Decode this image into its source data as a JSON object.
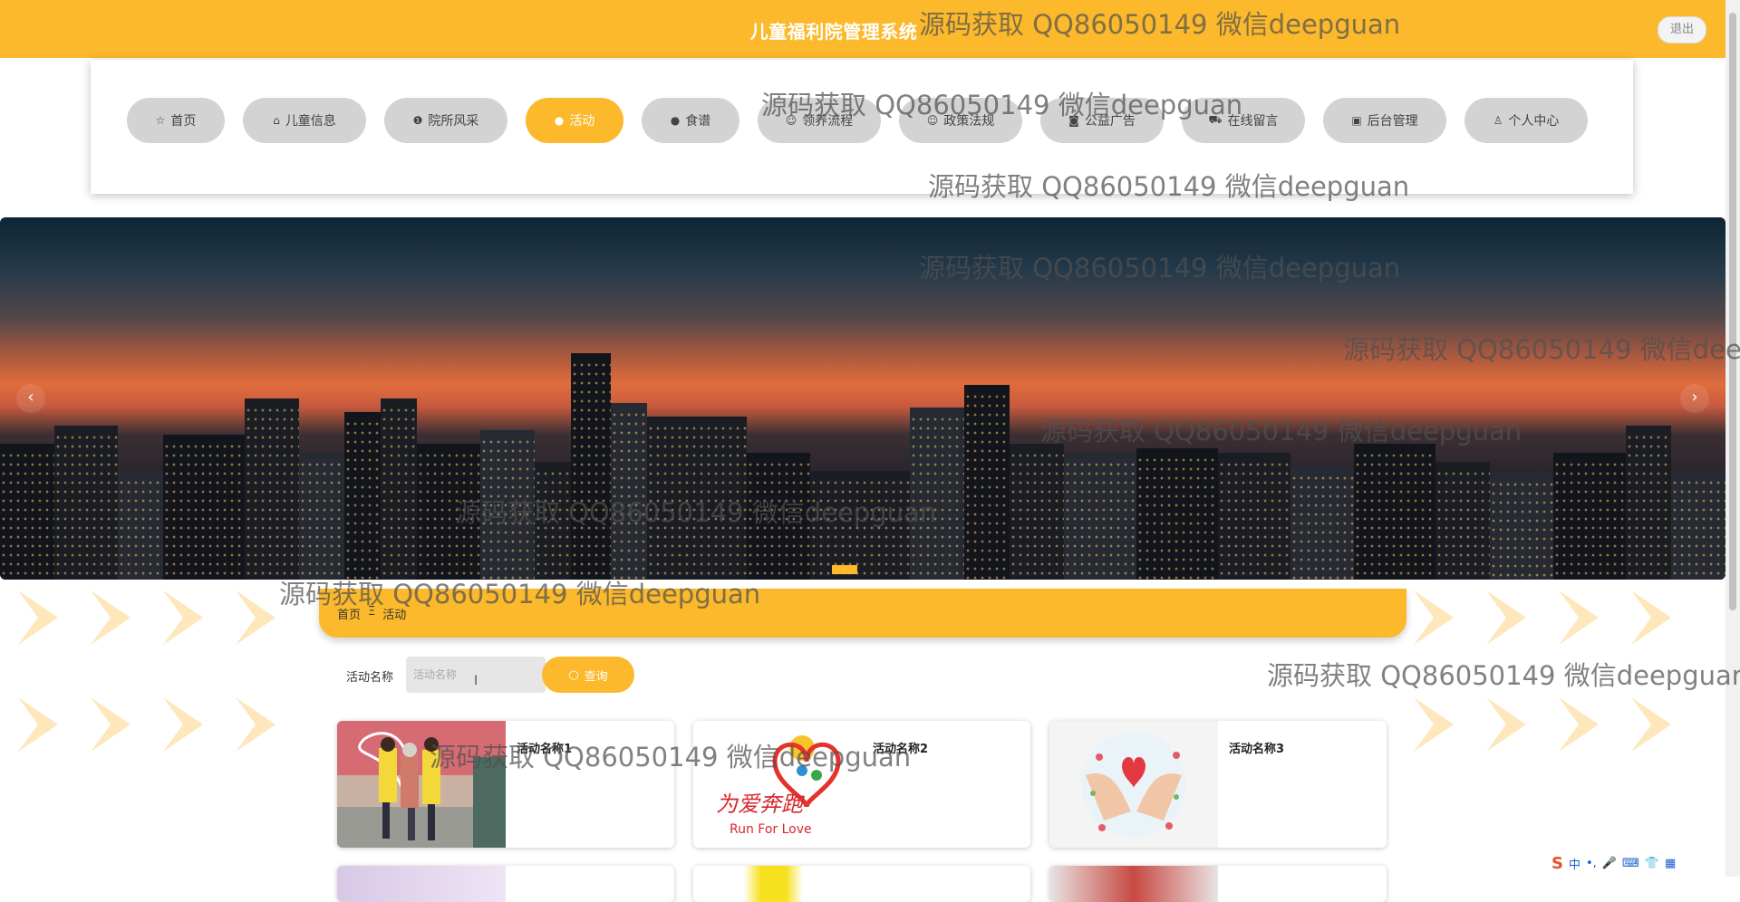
{
  "header": {
    "title": "儿童福利院管理系统",
    "logout_label": "退出"
  },
  "nav": {
    "items": [
      {
        "label": "首页",
        "icon": "☆"
      },
      {
        "label": "儿童信息",
        "icon": "⌂"
      },
      {
        "label": "院所风采",
        "icon": "❶"
      },
      {
        "label": "活动",
        "icon": "●",
        "active": true
      },
      {
        "label": "食谱",
        "icon": "●"
      },
      {
        "label": "领养流程",
        "icon": "☺"
      },
      {
        "label": "政策法规",
        "icon": "☺"
      },
      {
        "label": "公益广告",
        "icon": "◙"
      },
      {
        "label": "在线留言",
        "icon": "⛟"
      },
      {
        "label": "后台管理",
        "icon": "▣"
      },
      {
        "label": "个人中心",
        "icon": "♙"
      }
    ]
  },
  "banner": {
    "prev_label": "‹",
    "next_label": "›"
  },
  "breadcrumb": {
    "home": "首页",
    "separator": "Ξ",
    "current": "活动"
  },
  "search": {
    "label": "活动名称",
    "placeholder": "活动名称",
    "value": "",
    "button_label": "查询",
    "button_icon": "○"
  },
  "cards": [
    {
      "title": "活动名称1"
    },
    {
      "title": "活动名称2"
    },
    {
      "title": "活动名称3"
    }
  ],
  "card2_image_text": {
    "cn": "为爱奔跑",
    "en": "Run For Love"
  },
  "watermark": "源码获取 QQ86050149 微信deepguan",
  "ime": {
    "lang": "中",
    "extra": "•,"
  },
  "colors": {
    "accent": "#fbb92b",
    "nav_inactive": "#d3d3d3",
    "pattern": "#fde7bb"
  }
}
